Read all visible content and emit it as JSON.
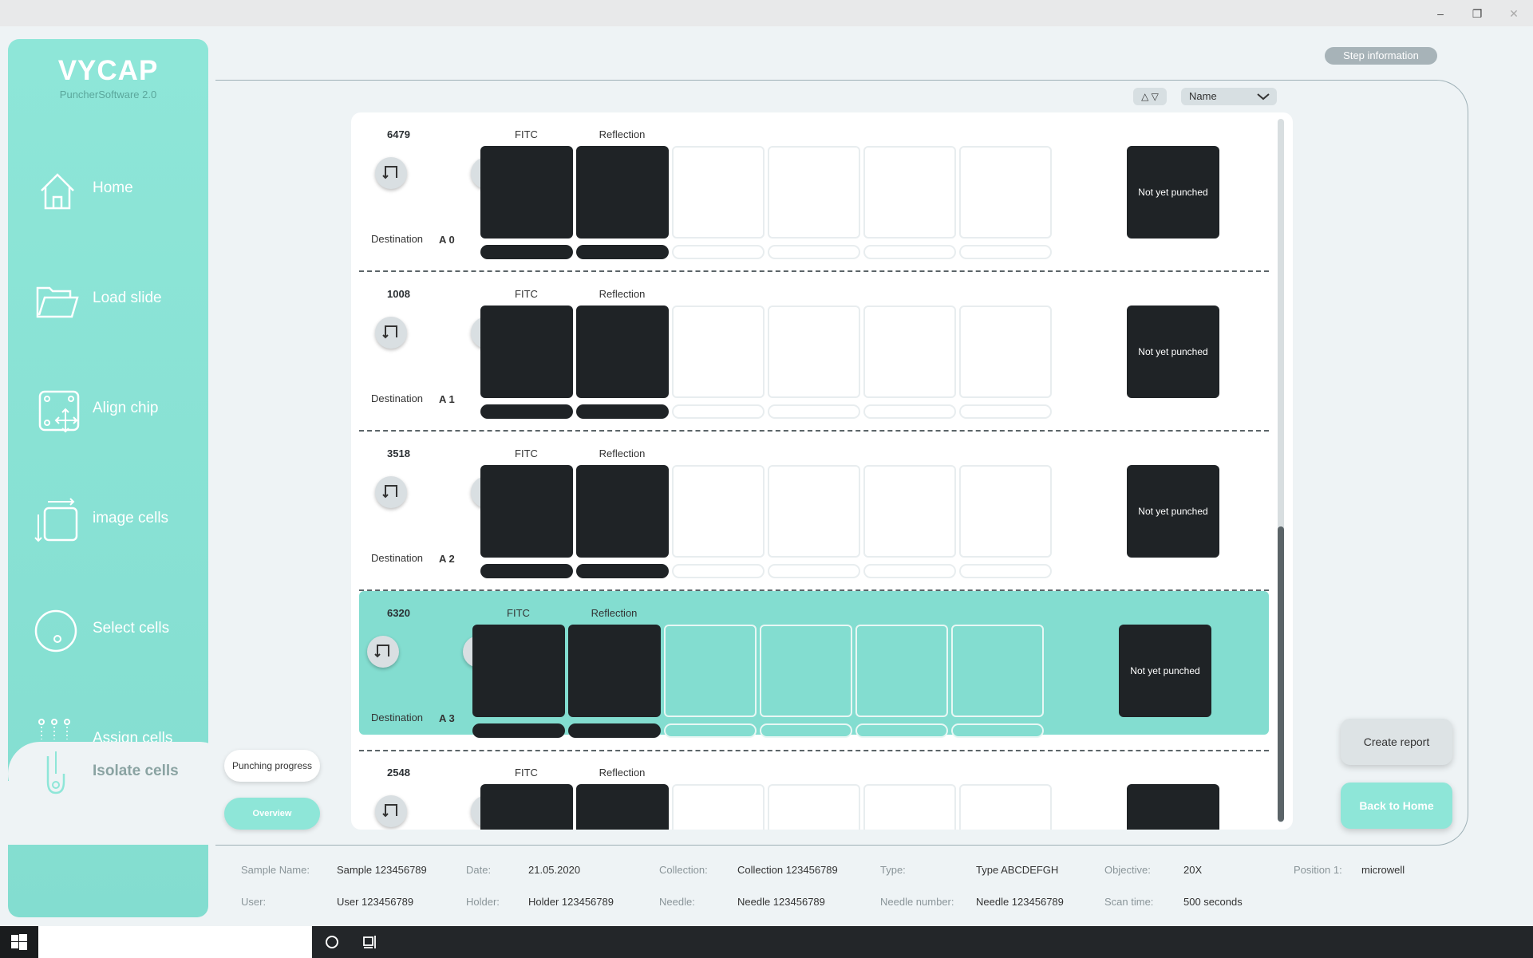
{
  "window": {
    "minimize": "–",
    "restore": "❐",
    "close": "✕"
  },
  "sidebar": {
    "logo": "VYCAP",
    "subtitle": "PuncherSoftware 2.0",
    "items": [
      {
        "label": "Home",
        "icon": "home-icon"
      },
      {
        "label": "Load slide",
        "icon": "folder-icon"
      },
      {
        "label": "Align chip",
        "icon": "align-chip-icon"
      },
      {
        "label": "image cells",
        "icon": "image-cells-icon"
      },
      {
        "label": "Select cells",
        "icon": "select-cells-icon"
      },
      {
        "label": "Assign cells",
        "icon": "assign-cells-icon"
      },
      {
        "label": "Isolate cells",
        "icon": "isolate-cells-icon",
        "active": true
      }
    ]
  },
  "header": {
    "step_info": "Step information",
    "sort_arrows": "△ ▽",
    "sort_by": "Name"
  },
  "progress_buttons": {
    "punching": "Punching progress",
    "overview": "Overview"
  },
  "cells": {
    "channel_1": "FITC",
    "channel_2": "Reflection",
    "destination_label": "Destination",
    "status": "Not yet punched",
    "rows": [
      {
        "id": "6479",
        "destination": "A 0"
      },
      {
        "id": "1008",
        "destination": "A 1"
      },
      {
        "id": "3518",
        "destination": "A 2"
      },
      {
        "id": "6320",
        "destination": "A 3",
        "highlighted": true
      },
      {
        "id": "2548",
        "destination": ""
      }
    ]
  },
  "actions": {
    "create_report": "Create report",
    "back_home": "Back to Home"
  },
  "info": {
    "sample_name_label": "Sample Name:",
    "sample_name": "Sample 123456789",
    "date_label": "Date:",
    "date": "21.05.2020",
    "collection_label": "Collection:",
    "collection": "Collection 123456789",
    "type_label": "Type:",
    "type": "Type ABCDEFGH",
    "objective_label": "Objective:",
    "objective": "20X",
    "position_label": "Position 1:",
    "position": "microwell",
    "user_label": "User:",
    "user": "User 123456789",
    "holder_label": "Holder:",
    "holder": "Holder 123456789",
    "needle_label": "Needle:",
    "needle": "Needle 123456789",
    "needle_number_label": "Needle number:",
    "needle_number": "Needle 123456789",
    "scan_time_label": "Scan time:",
    "scan_time": "500 seconds"
  },
  "colors": {
    "accent": "#8ee6d8",
    "dark_tile": "#1f2326",
    "background": "#eef3f5"
  }
}
